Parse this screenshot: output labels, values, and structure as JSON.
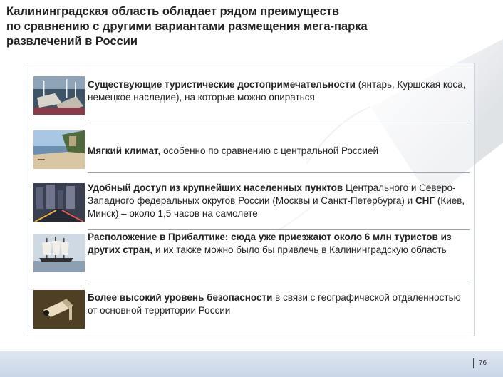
{
  "slide": {
    "title_lines": [
      "Калининградская область обладает рядом преимуществ",
      "по сравнению с другими вариантами размещения мега-парка",
      "развлечений в России"
    ],
    "page_number": "76"
  },
  "items": [
    {
      "bold": "Существующие туристические достопримечательности",
      "rest": " (янтарь, Куршская коса, немецкое наследие), на которые можно опираться",
      "image": "harbor-yachts-photo"
    },
    {
      "bold": "Мягкий климат,",
      "rest": " особенно по сравнению с центральной Россией",
      "image": "coastal-beach-photo"
    },
    {
      "bold": "Удобный доступ из крупнейших населенных пунктов",
      "rest": " Центрального и Северо-Западного федеральных округов России (Москвы и Санкт-Петербурга) и ",
      "bold2": "СНГ",
      "rest2": " (Киев, Минск) – около 1,5 часов на самолете",
      "image": "city-traffic-photo"
    },
    {
      "bold": "Расположение в Прибалтике: сюда уже приезжают около 6 млн туристов из других стран,",
      "rest": " и их также можно было бы привлечь в Калининградскую область",
      "image": "sailing-ship-photo"
    },
    {
      "bold": "Более высокий уровень безопасности",
      "rest": " в связи с географической отдаленностью от основной территории России",
      "image": "security-camera-photo"
    }
  ]
}
